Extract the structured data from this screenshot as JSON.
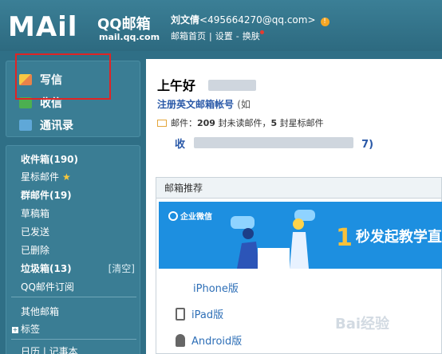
{
  "header": {
    "logo_text": "MAil",
    "logo_cn": "QQ邮箱",
    "logo_url": "mail.qq.com",
    "user_name": "刘文倩",
    "user_email": "<495664270@qq.com>",
    "links": [
      "邮箱首页",
      "设置",
      "换肤"
    ]
  },
  "sidebar": {
    "nav": [
      {
        "label": "写信",
        "icon": "pencil-icon"
      },
      {
        "label": "收信",
        "icon": "inbox-icon"
      },
      {
        "label": "通讯录",
        "icon": "contacts-icon"
      }
    ],
    "folders": [
      {
        "label": "收件箱(190)",
        "bold": true
      },
      {
        "label": "星标邮件",
        "bold": false
      },
      {
        "label": "群邮件(19)",
        "bold": true
      },
      {
        "label": "草稿箱",
        "bold": false
      },
      {
        "label": "已发送",
        "bold": false
      },
      {
        "label": "已删除",
        "bold": false
      },
      {
        "label": "垃圾箱(13)",
        "bold": true
      },
      {
        "label": "QQ邮件订阅",
        "bold": false
      },
      {
        "label": "其他邮箱",
        "bold": false
      },
      {
        "label": "标签",
        "bold": false
      },
      {
        "label": "日历 | 记事本",
        "bold": false
      }
    ],
    "clear_label": "[清空]"
  },
  "main": {
    "greeting": "上午好",
    "register_link": "注册英文邮箱帐号",
    "register_suffix": "(如",
    "mail_label": "邮件：",
    "unread_count": "209",
    "unread_label": "封未读邮件，",
    "star_count": "5",
    "star_label": "封星标邮件",
    "address_prefix": "收",
    "address_suffix": "7)",
    "panel_title": "邮箱推荐",
    "banner_brand": "企业微信",
    "banner_number": "1",
    "banner_text": "秒发起教学直",
    "apps": [
      "iPhone版",
      "iPad版",
      "Android版"
    ],
    "watermark": "Bai经验"
  },
  "colors": {
    "header": "#3b7f96",
    "sidebar": "#2f6f86",
    "highlight": "#e02424",
    "link": "#2a59a8",
    "banner": "#1d8fe0"
  }
}
